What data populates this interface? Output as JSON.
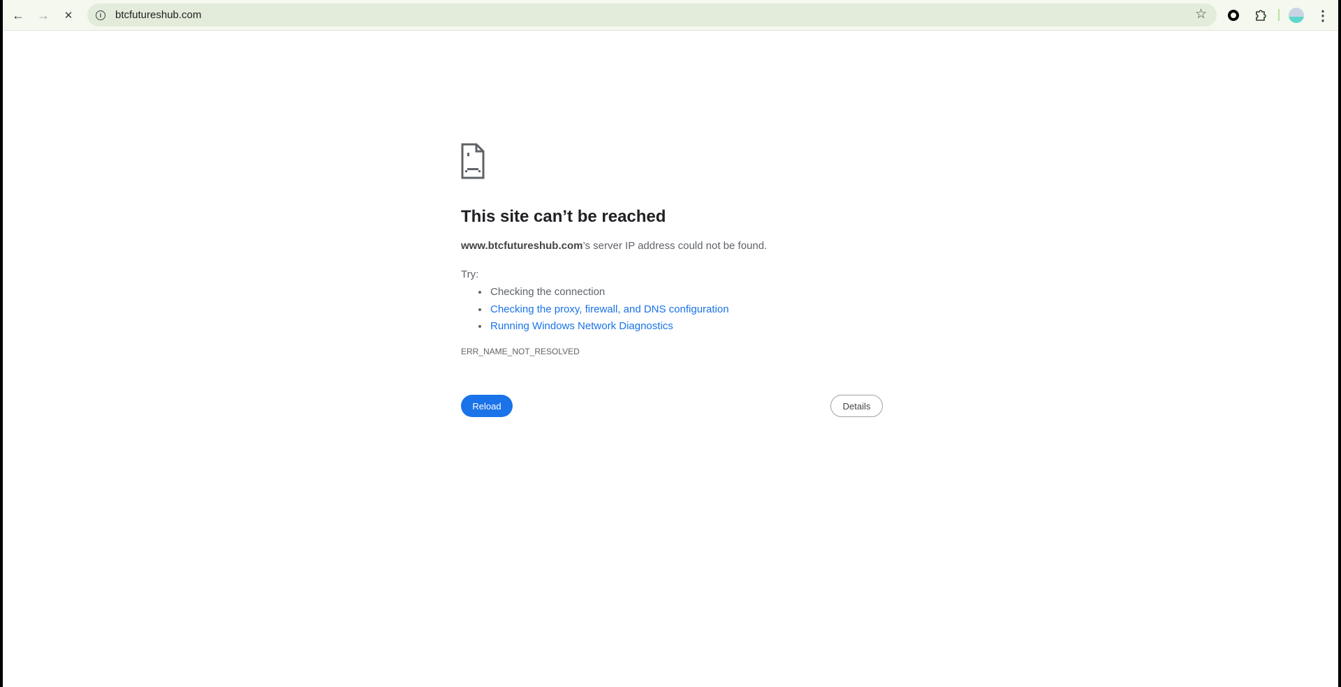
{
  "browser": {
    "url": "btcfutureshub.com",
    "icons": [
      "back-arrow-icon",
      "forward-arrow-icon",
      "stop-icon",
      "info-icon",
      "star-icon",
      "extension-circle-icon",
      "puzzle-icon",
      "avatar",
      "more-vert-icon"
    ],
    "glyphs": {
      "back": "←",
      "forward": "→",
      "stop": "✕",
      "star": "☆",
      "more": "⋮",
      "info": "i"
    }
  },
  "error_page": {
    "title": "This site can’t be reached",
    "host": "www.btcfutureshub.com",
    "message_suffix": "’s server IP address could not be found.",
    "try_label": "Try:",
    "suggestions": [
      "Checking the connection",
      "Checking the proxy, firewall, and DNS configuration",
      "Running Windows Network Diagnostics"
    ],
    "error_code": "ERR_NAME_NOT_RESOLVED",
    "reload_label": "Reload",
    "details_label": "Details",
    "accent": "#1a73e8"
  }
}
